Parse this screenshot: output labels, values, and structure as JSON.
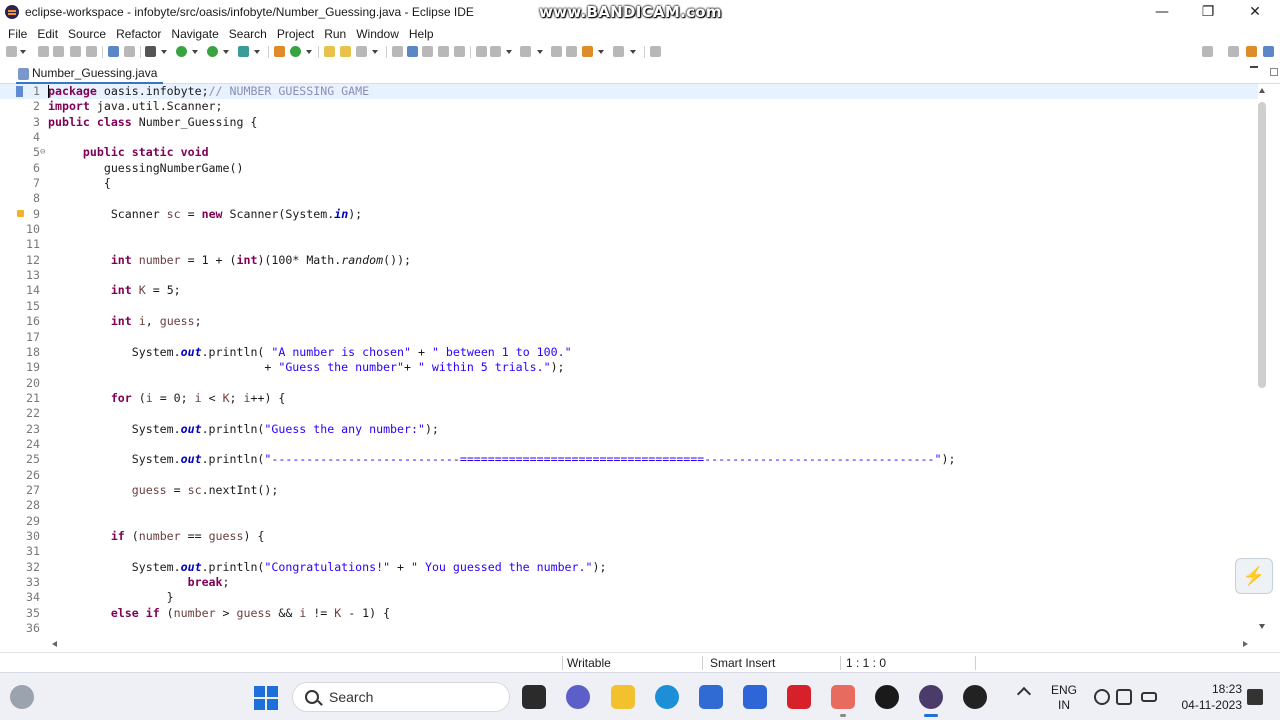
{
  "window": {
    "title": "eclipse-workspace - infobyte/src/oasis/infobyte/Number_Guessing.java - Eclipse IDE",
    "watermark": "www.BANDICAM.com",
    "minimize": "—",
    "maximize": "❐",
    "close": "✕"
  },
  "menu": [
    "File",
    "Edit",
    "Source",
    "Refactor",
    "Navigate",
    "Search",
    "Project",
    "Run",
    "Window",
    "Help"
  ],
  "editor": {
    "tab_label": "Number_Guessing.java",
    "lines": [
      {
        "n": "1",
        "html": "<span class=\"kw\">package</span> oasis.infobyte;<span class=\"cm\">// NUMBER GUESSING GAME</span>"
      },
      {
        "n": "2",
        "html": "<span class=\"kw\">import</span> java.util.Scanner;"
      },
      {
        "n": "3",
        "html": "<span class=\"kw\">public class</span> Number_Guessing {"
      },
      {
        "n": "4",
        "html": ""
      },
      {
        "n": "5",
        "html": "     <span class=\"kw\">public static void</span>"
      },
      {
        "n": "6",
        "html": "        guessingNumberGame()"
      },
      {
        "n": "7",
        "html": "        {"
      },
      {
        "n": "8",
        "html": ""
      },
      {
        "n": "9",
        "html": "         Scanner <span class=\"var\">sc</span> = <span class=\"kw\">new</span> Scanner(System.<span class=\"fld\">in</span>);"
      },
      {
        "n": "10",
        "html": ""
      },
      {
        "n": "11",
        "html": ""
      },
      {
        "n": "12",
        "html": "         <span class=\"kw\">int</span> <span class=\"var\">number</span> = 1 + (<span class=\"kw\">int</span>)(100* Math.<span class=\"it\">random</span>());"
      },
      {
        "n": "13",
        "html": ""
      },
      {
        "n": "14",
        "html": "         <span class=\"kw\">int</span> <span class=\"var\">K</span> = 5;"
      },
      {
        "n": "15",
        "html": ""
      },
      {
        "n": "16",
        "html": "         <span class=\"kw\">int</span> <span class=\"var\">i</span>, <span class=\"var\">guess</span>;"
      },
      {
        "n": "17",
        "html": ""
      },
      {
        "n": "18",
        "html": "            System.<span class=\"fld\">out</span>.println( <span class=\"str\">\"A number is chosen\"</span> + <span class=\"str\">\" between 1 to 100.\"</span>"
      },
      {
        "n": "19",
        "html": "                               + <span class=\"str\">\"Guess the number\"</span>+ <span class=\"str\">\" within 5 trials.\"</span>);"
      },
      {
        "n": "20",
        "html": ""
      },
      {
        "n": "21",
        "html": "         <span class=\"kw\">for</span> (<span class=\"var\">i</span> = 0; <span class=\"var\">i</span> &lt; <span class=\"var\">K</span>; <span class=\"var\">i</span>++) {"
      },
      {
        "n": "22",
        "html": ""
      },
      {
        "n": "23",
        "html": "            System.<span class=\"fld\">out</span>.println(<span class=\"str\">\"Guess the any number:\"</span>);"
      },
      {
        "n": "24",
        "html": ""
      },
      {
        "n": "25",
        "html": "            System.<span class=\"fld\">out</span>.println(<span class=\"str\">\"---------------------------===================================---------------------------------\"</span>);"
      },
      {
        "n": "26",
        "html": ""
      },
      {
        "n": "27",
        "html": "            <span class=\"var\">guess</span> = <span class=\"var\">sc</span>.nextInt();"
      },
      {
        "n": "28",
        "html": ""
      },
      {
        "n": "29",
        "html": ""
      },
      {
        "n": "30",
        "html": "         <span class=\"kw\">if</span> (<span class=\"var\">number</span> == <span class=\"var\">guess</span>) {"
      },
      {
        "n": "31",
        "html": ""
      },
      {
        "n": "32",
        "html": "            System.<span class=\"fld\">out</span>.println(<span class=\"str\">\"Congratulations!\"</span> + <span class=\"str\">\" You guessed the number.\"</span>);"
      },
      {
        "n": "33",
        "html": "                    <span class=\"kw\">break</span>;"
      },
      {
        "n": "34",
        "html": "                 }"
      },
      {
        "n": "35",
        "html": "         <span class=\"kw\">else if</span> (<span class=\"var\">number</span> &gt; <span class=\"var\">guess</span> &amp;&amp; <span class=\"var\">i</span> != <span class=\"var\">K</span> - 1) {"
      },
      {
        "n": "36",
        "html": ""
      }
    ]
  },
  "status": {
    "writable": "Writable",
    "insert_mode": "Smart Insert",
    "position": "1 : 1 : 0"
  },
  "taskbar": {
    "search_label": "Search",
    "lang_line1": "ENG",
    "lang_line2": "IN",
    "time": "18:23",
    "date": "04-11-2023"
  },
  "colors": {
    "keyword": "#7f0055",
    "string": "#2a00ff",
    "comment": "#8a8fb5",
    "field": "#0000c0",
    "variable": "#6a3e3e",
    "accent": "#1e6fd9"
  }
}
